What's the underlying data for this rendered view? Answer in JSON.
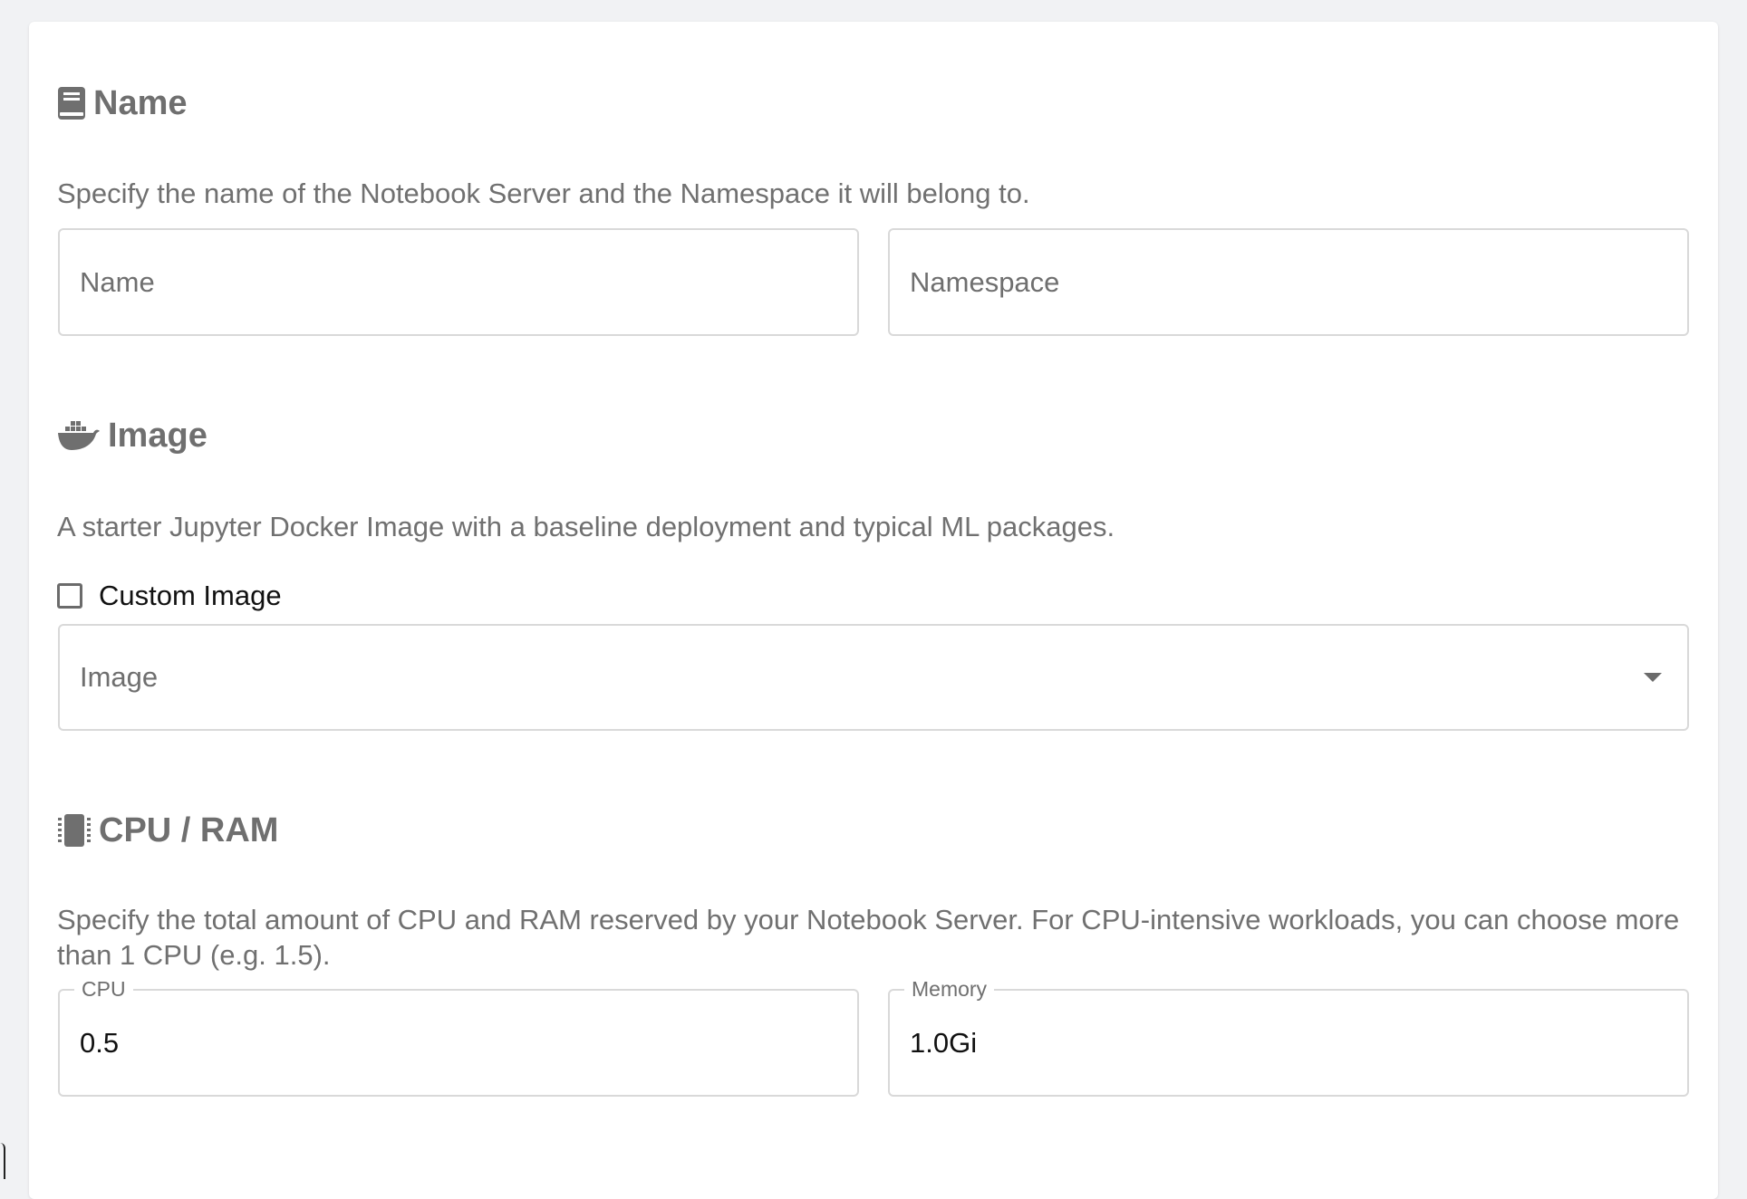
{
  "name_section": {
    "title": "Name",
    "icon": "book-icon",
    "description": "Specify the name of the Notebook Server and the Namespace it will belong to.",
    "name_placeholder": "Name",
    "namespace_placeholder": "Namespace"
  },
  "image_section": {
    "title": "Image",
    "icon": "docker-icon",
    "description": "A starter Jupyter Docker Image with a baseline deployment and typical ML packages.",
    "custom_image_label": "Custom Image",
    "custom_image_checked": false,
    "image_select_label": "Image"
  },
  "cpu_section": {
    "title": "CPU / RAM",
    "icon": "chip-icon",
    "description": "Specify the total amount of CPU and RAM reserved by your Notebook Server. For CPU-intensive workloads, you can choose more than 1 CPU (e.g. 1.5).",
    "cpu_label": "CPU",
    "cpu_value": "0.5",
    "memory_label": "Memory",
    "memory_value": "1.0Gi"
  },
  "colors": {
    "background": "#f1f2f4",
    "card": "#ffffff",
    "heading": "#6f6f6f",
    "border": "#d9d9d9"
  }
}
